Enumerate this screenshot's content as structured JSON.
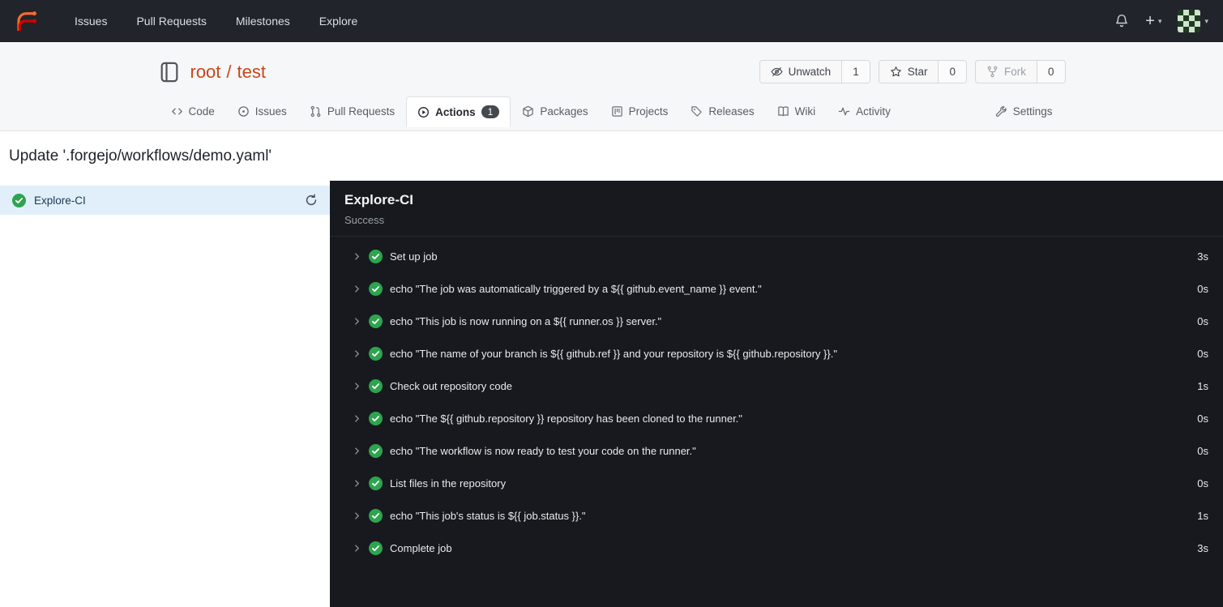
{
  "navbar": {
    "items": [
      {
        "label": "Issues"
      },
      {
        "label": "Pull Requests"
      },
      {
        "label": "Milestones"
      },
      {
        "label": "Explore"
      }
    ]
  },
  "repo": {
    "owner": "root",
    "separator": "/",
    "name": "test",
    "actions": [
      {
        "label": "Unwatch",
        "count": "1"
      },
      {
        "label": "Star",
        "count": "0"
      },
      {
        "label": "Fork",
        "count": "0"
      }
    ]
  },
  "tabs": [
    {
      "label": "Code"
    },
    {
      "label": "Issues"
    },
    {
      "label": "Pull Requests"
    },
    {
      "label": "Actions",
      "badge": "1",
      "active": true
    },
    {
      "label": "Packages"
    },
    {
      "label": "Projects"
    },
    {
      "label": "Releases"
    },
    {
      "label": "Wiki"
    },
    {
      "label": "Activity"
    },
    {
      "label": "Settings"
    }
  ],
  "page": {
    "title": "Update '.forgejo/workflows/demo.yaml'"
  },
  "sidebar": {
    "job": {
      "label": "Explore-CI"
    }
  },
  "run": {
    "title": "Explore-CI",
    "status": "Success",
    "steps": [
      {
        "label": "Set up job",
        "duration": "3s"
      },
      {
        "label": "echo \"The job was automatically triggered by a ${{ github.event_name }} event.\"",
        "duration": "0s"
      },
      {
        "label": "echo \"This job is now running on a ${{ runner.os }} server.\"",
        "duration": "0s"
      },
      {
        "label": "echo \"The name of your branch is ${{ github.ref }} and your repository is ${{ github.repository }}.\"",
        "duration": "0s"
      },
      {
        "label": "Check out repository code",
        "duration": "1s"
      },
      {
        "label": "echo \"The ${{ github.repository }} repository has been cloned to the runner.\"",
        "duration": "0s"
      },
      {
        "label": "echo \"The workflow is now ready to test your code on the runner.\"",
        "duration": "0s"
      },
      {
        "label": "List files in the repository",
        "duration": "0s"
      },
      {
        "label": "echo \"This job's status is ${{ job.status }}.\"",
        "duration": "1s"
      },
      {
        "label": "Complete job",
        "duration": "3s"
      }
    ]
  },
  "colors": {
    "brand_orange": "#ff6b2b",
    "repo_link": "#c8461b",
    "success_green": "#2da44e",
    "selected_job_bg": "#e1effb"
  }
}
